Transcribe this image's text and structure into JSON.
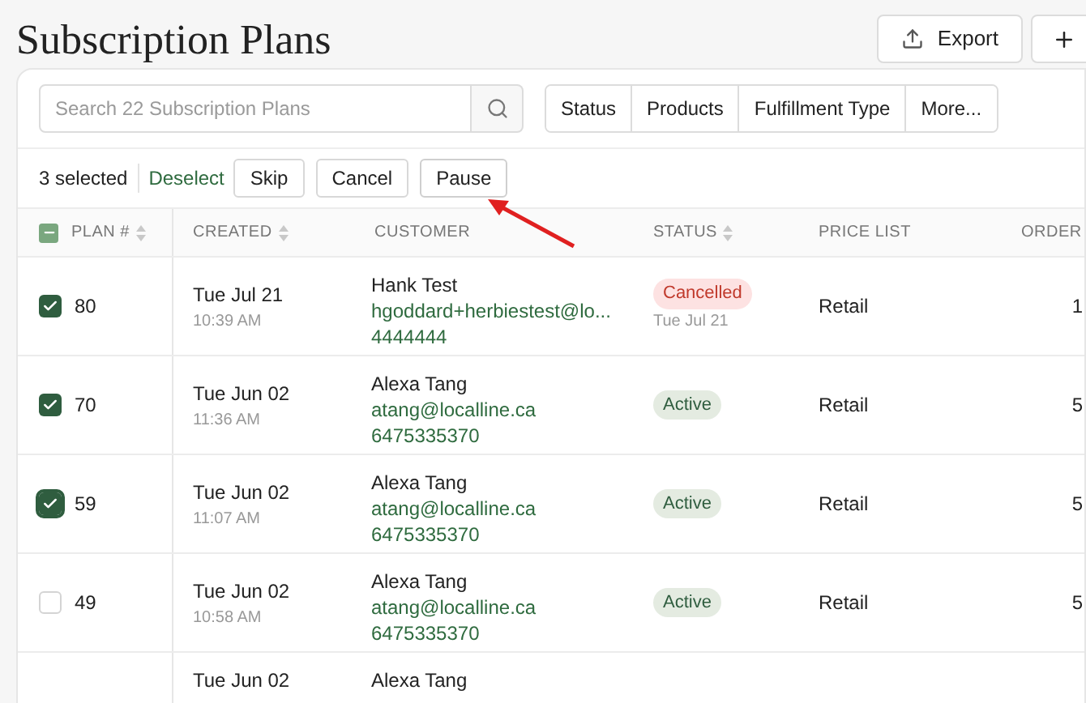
{
  "page": {
    "title": "Subscription Plans"
  },
  "header_actions": [
    {
      "kind": "export",
      "label": "Export"
    },
    {
      "kind": "add"
    }
  ],
  "search": {
    "placeholder": "Search 22 Subscription Plans"
  },
  "filters": [
    "Status",
    "Products",
    "Fulfillment Type",
    "More..."
  ],
  "bulk_bar": {
    "count": "3 selected",
    "deselect": "Deselect",
    "buttons": [
      "Skip",
      "Cancel",
      "Pause"
    ]
  },
  "annotation": {
    "kind": "arrow"
  },
  "table": {
    "select_all": {
      "checked": true,
      "mixed": true
    },
    "columns": [
      {
        "label": "PLAN #",
        "sortable": true
      },
      {
        "label": "CREATED",
        "sortable": true
      },
      {
        "label": "CUSTOMER",
        "sortable": false
      },
      {
        "label": "STATUS",
        "sortable": true
      },
      {
        "label": "PRICE LIST",
        "sortable": false
      },
      {
        "label": "ORDER",
        "sortable": false
      }
    ],
    "rows": [
      {
        "checked": true,
        "focused": false,
        "plan": "80",
        "date": "Tue Jul 21",
        "time": "10:39 AM",
        "name": "Hank Test",
        "email": "hgoddard+herbiestest@lo...",
        "phone": "4444444",
        "status": {
          "label": "Cancelled",
          "kind": "cancelled",
          "date": "Tue Jul 21"
        },
        "price_list": "Retail",
        "orders": "1"
      },
      {
        "checked": true,
        "focused": false,
        "plan": "70",
        "date": "Tue Jun 02",
        "time": "11:36 AM",
        "name": "Alexa Tang",
        "email": "atang@localline.ca",
        "phone": "6475335370",
        "status": {
          "label": "Active",
          "kind": "active"
        },
        "price_list": "Retail",
        "orders": "5"
      },
      {
        "checked": true,
        "focused": true,
        "plan": "59",
        "date": "Tue Jun 02",
        "time": "11:07 AM",
        "name": "Alexa Tang",
        "email": "atang@localline.ca",
        "phone": "6475335370",
        "status": {
          "label": "Active",
          "kind": "active"
        },
        "price_list": "Retail",
        "orders": "5"
      },
      {
        "checked": false,
        "focused": false,
        "plan": "49",
        "date": "Tue Jun 02",
        "time": "10:58 AM",
        "name": "Alexa Tang",
        "email": "atang@localline.ca",
        "phone": "6475335370",
        "status": {
          "label": "Active",
          "kind": "active"
        },
        "price_list": "Retail",
        "orders": "5"
      },
      {
        "date": "Tue Jun 02",
        "name": "Alexa Tang"
      }
    ]
  }
}
